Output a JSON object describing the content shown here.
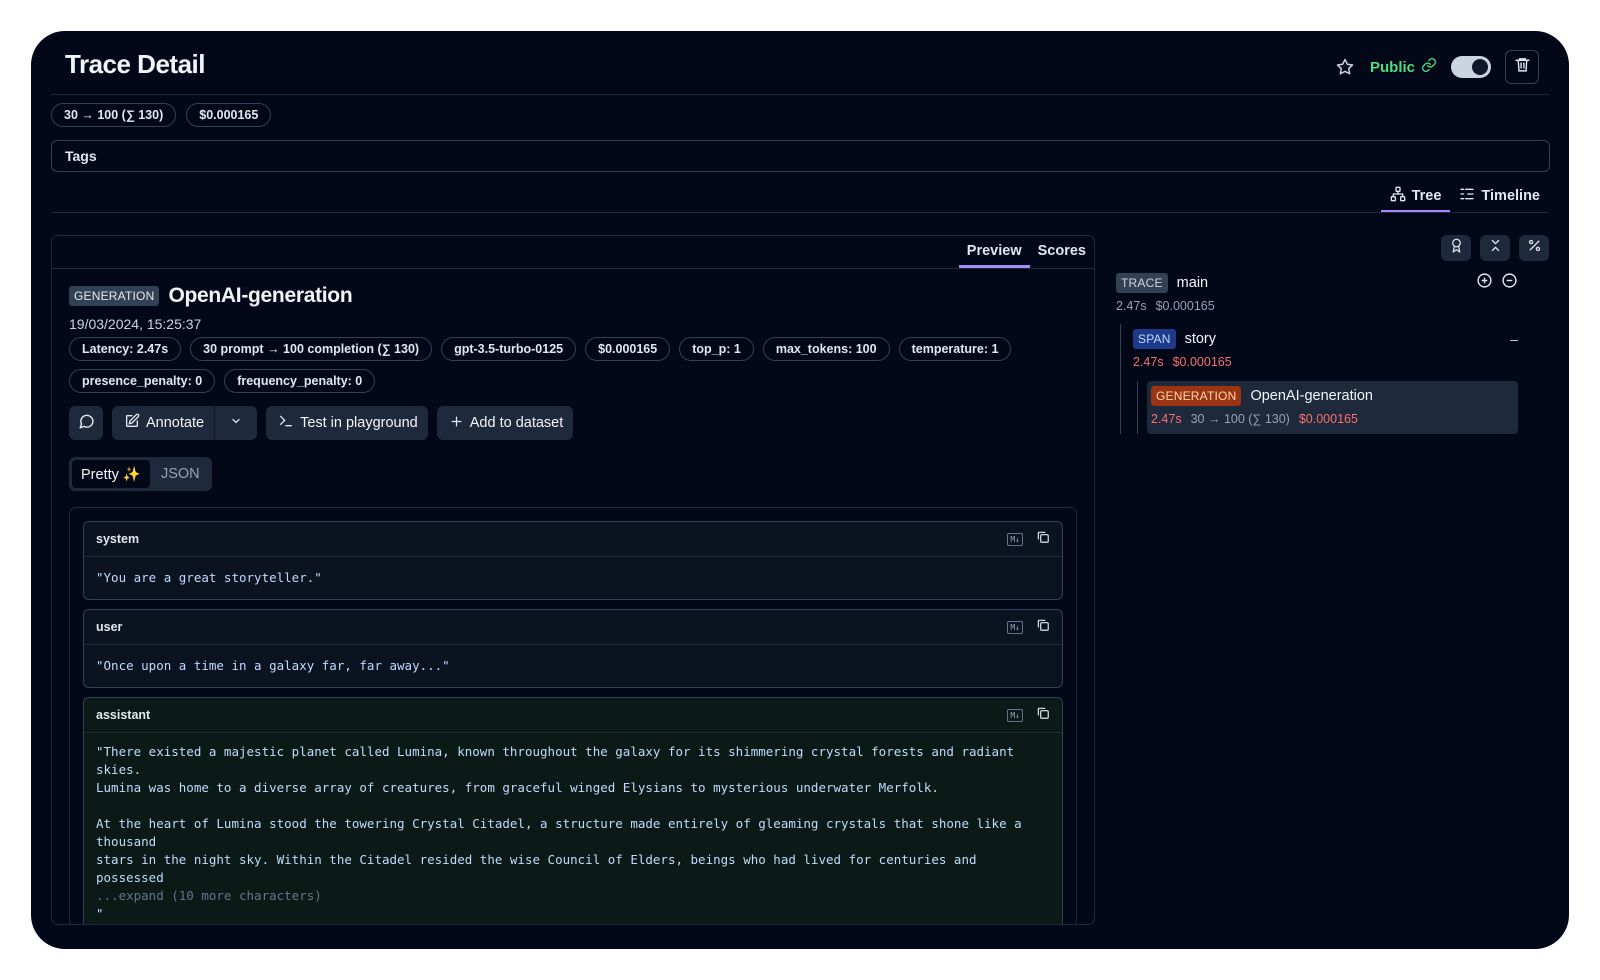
{
  "header": {
    "title": "Trace Detail",
    "public_label": "Public",
    "public_on": true,
    "accent_public": "#4ade80"
  },
  "trace_pills": [
    "30 → 100 (∑ 130)",
    "$0.000165"
  ],
  "tags_label": "Tags",
  "view_tabs": {
    "tree": "Tree",
    "timeline": "Timeline",
    "active": "Tree"
  },
  "panel": {
    "tabs": {
      "preview": "Preview",
      "scores": "Scores",
      "active": "Preview"
    },
    "type_badge": "GENERATION",
    "name": "OpenAI-generation",
    "timestamp": "19/03/2024, 15:25:37",
    "metrics": [
      "Latency: 2.47s",
      "30 prompt → 100 completion (∑ 130)",
      "gpt-3.5-turbo-0125",
      "$0.000165",
      "top_p: 1",
      "max_tokens: 100",
      "temperature: 1",
      "presence_penalty: 0",
      "frequency_penalty: 0"
    ],
    "actions": {
      "annotate": "Annotate",
      "playground": "Test in playground",
      "dataset": "Add to dataset"
    },
    "view_toggle": {
      "pretty": "Pretty ✨",
      "json": "JSON",
      "active": "Pretty"
    },
    "messages": [
      {
        "role": "system",
        "content": "\"You are a great storyteller.\""
      },
      {
        "role": "user",
        "content": "\"Once upon a time in a galaxy far, far away...\""
      },
      {
        "role": "assistant",
        "content": "\"There existed a majestic planet called Lumina, known throughout the galaxy for its shimmering crystal forests and radiant skies.\nLumina was home to a diverse array of creatures, from graceful winged Elysians to mysterious underwater Merfolk.\n\nAt the heart of Lumina stood the towering Crystal Citadel, a structure made entirely of gleaming crystals that shone like a thousand\nstars in the night sky. Within the Citadel resided the wise Council of Elders, beings who had lived for centuries and possessed\n",
        "expand": "...expand (10 more characters)",
        "tail": "\""
      }
    ],
    "md_label": "M↓"
  },
  "tree": {
    "trace": {
      "badge": "TRACE",
      "name": "main",
      "latency": "2.47s",
      "cost": "$0.000165"
    },
    "span": {
      "badge": "SPAN",
      "name": "story",
      "latency": "2.47s",
      "cost": "$0.000165",
      "collapse": "–"
    },
    "generation": {
      "badge": "GENERATION",
      "name": "OpenAI-generation",
      "latency": "2.47s",
      "tokens": "30 → 100 (∑ 130)",
      "cost": "$0.000165"
    }
  }
}
